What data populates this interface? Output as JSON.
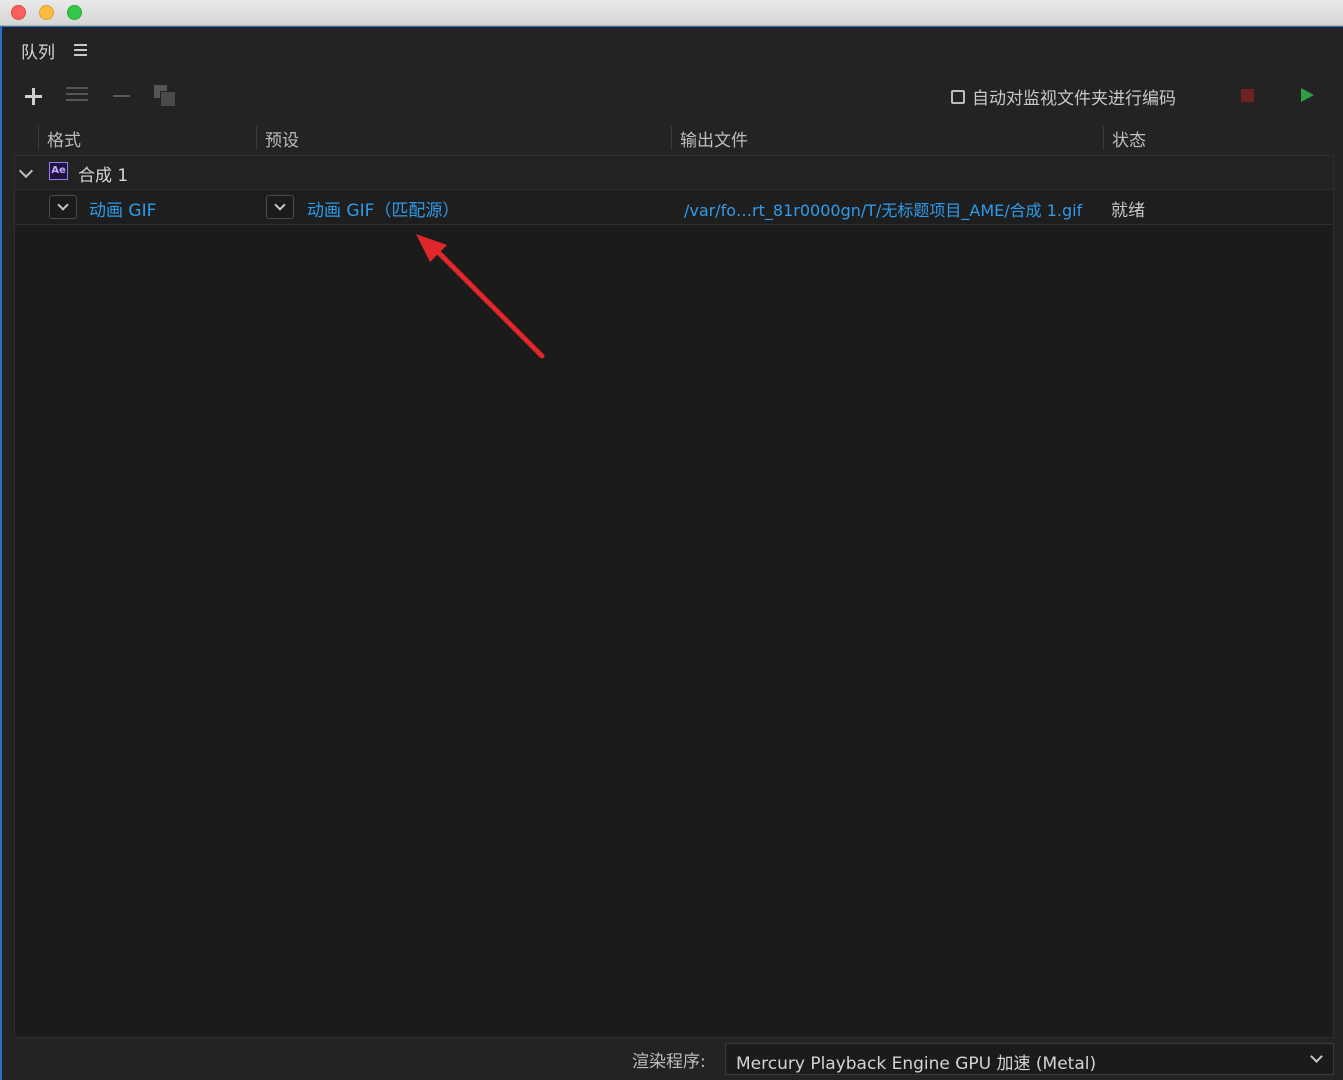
{
  "window": {
    "close": "close",
    "minimize": "minimize",
    "zoom": "zoom"
  },
  "panel": {
    "title": "队列"
  },
  "toolbar": {
    "add_icon": "plus-icon",
    "settings_icon": "sliders-icon",
    "remove_icon": "minus-icon",
    "duplicate_icon": "duplicate-icon",
    "auto_watch_label": "自动对监视文件夹进行编码",
    "stop_color": "#6e2222",
    "start_color": "#2ea043"
  },
  "columns": {
    "format": "格式",
    "preset": "预设",
    "output": "输出文件",
    "status": "状态"
  },
  "queue": {
    "group": {
      "icon_label": "Ae",
      "name": "合成 1"
    },
    "item": {
      "format": "动画 GIF",
      "preset": "动画 GIF（匹配源）",
      "output": "/var/fo…rt_81r0000gn/T/无标题项目_AME/合成 1.gif",
      "status": "就绪"
    }
  },
  "footer": {
    "renderer_label": "渲染程序:",
    "renderer_value": "Mercury Playback Engine GPU 加速 (Metal)"
  },
  "annotation_color": "#e0282a",
  "link_color": "#2f9bea"
}
